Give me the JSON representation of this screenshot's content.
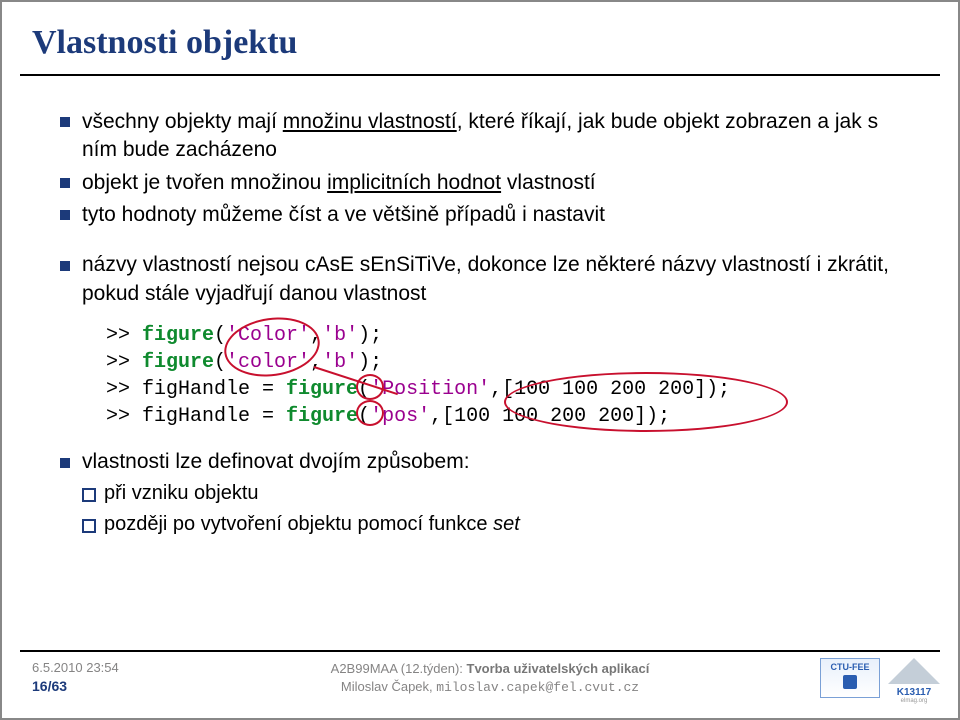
{
  "title": "Vlastnosti objektu",
  "bullets": {
    "b1_a": "všechny objekty mají ",
    "b1_b": "množinu vlastností",
    "b1_c": ", které říkají, jak bude objekt zobrazen a jak s ním bude zacházeno",
    "b2_a": "objekt je tvořen množinou ",
    "b2_b": "implicitních hodnot",
    "b2_c": " vlastností",
    "b3": "tyto hodnoty můžeme číst a ve většině případů i nastavit",
    "b4": "názvy vlastností nejsou cAsE sEnSiTiVe, dokonce lze některé názvy vlastností i zkrátit, pokud stále vyjadřují danou vlastnost",
    "b5": "vlastnosti lze definovat dvojím způsobem:",
    "s1": "při vzniku objektu",
    "s2_a": "později po vytvoření objektu pomocí funkce ",
    "s2_b": "set"
  },
  "code": {
    "l1_a": ">> ",
    "l1_b": "figure",
    "l1_c": "(",
    "l1_d": "'Color'",
    "l1_e": ",",
    "l1_f": "'b'",
    "l1_g": ");",
    "l2_a": ">> ",
    "l2_b": "figure",
    "l2_c": "(",
    "l2_d": "'color'",
    "l2_e": ",",
    "l2_f": "'b'",
    "l2_g": ");",
    "l3_a": ">> figHandle = ",
    "l3_b": "figure",
    "l3_c": "(",
    "l3_d": "'Position'",
    "l3_e": ",[100 100 200 200]);",
    "l4_a": ">> figHandle = ",
    "l4_b": "figure",
    "l4_c": "(",
    "l4_d": "'pos'",
    "l4_e": ",[100 100 200 200]);"
  },
  "footer": {
    "date": "6.5.2010 23:54",
    "page": "16/63",
    "course": "A2B99MAA (12.týden): ",
    "topic": "Tvorba uživatelských aplikací",
    "author": "Miloslav Čapek, ",
    "email": "miloslav.capek@fel.cvut.cz",
    "logo1a": "CTU-FEE",
    "logo2a": "K13117",
    "logo2b": "elmag.org"
  }
}
